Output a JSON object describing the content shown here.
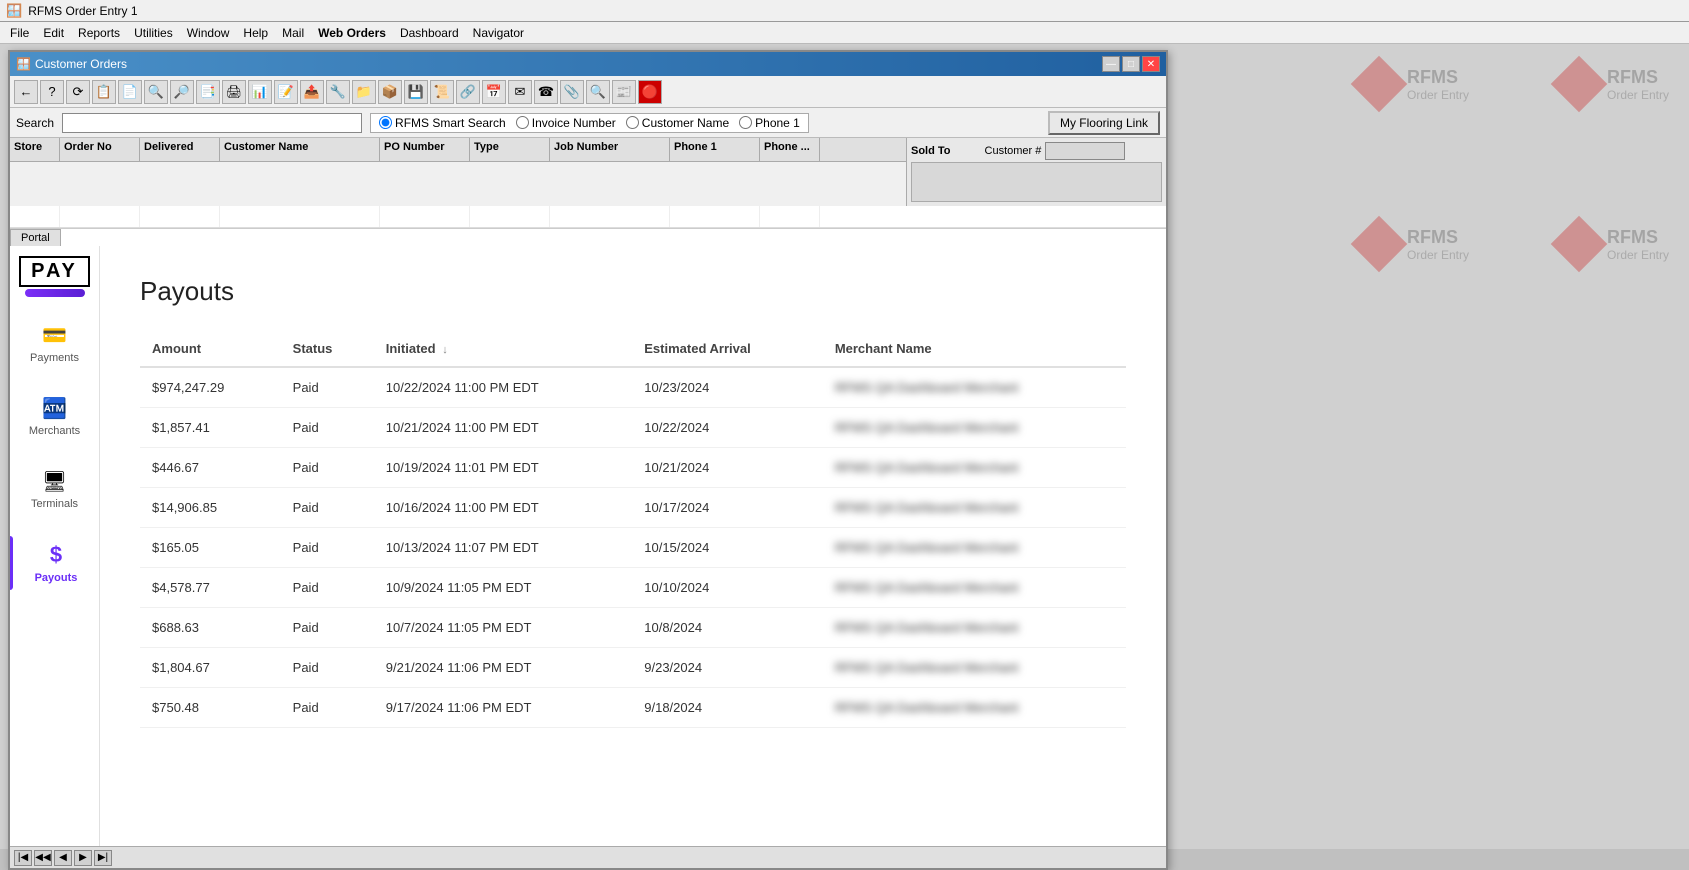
{
  "app": {
    "title": "RFMS Order Entry 1"
  },
  "menu": {
    "items": [
      "File",
      "Edit",
      "Reports",
      "Utilities",
      "Window",
      "Help",
      "Mail",
      "Web Orders",
      "Dashboard",
      "Navigator"
    ]
  },
  "window": {
    "title": "Customer Orders",
    "controls": [
      "—",
      "□",
      "✕"
    ]
  },
  "toolbar": {
    "buttons": [
      "←",
      "?",
      "⟳",
      "📋",
      "🗒",
      "🔍",
      "🔎",
      "📄",
      "🖨",
      "📑",
      "📊",
      "🔧",
      "📝",
      "📤",
      "📧",
      "🗃",
      "📦",
      "💾",
      "📜",
      "🔗",
      "📌",
      "🗂",
      "📮",
      "📅",
      "✉",
      "☎",
      "📎",
      "🔍",
      "📰",
      "🔴"
    ]
  },
  "search": {
    "label": "Search",
    "placeholder": "",
    "options": [
      "RFMS Smart Search",
      "Invoice Number",
      "Customer Name",
      "Phone 1"
    ],
    "selected": "RFMS Smart Search",
    "flooring_button": "My Flooring Link"
  },
  "columns": {
    "headers": [
      "Store",
      "Order No",
      "Delivered",
      "Customer Name",
      "PO Number",
      "Type",
      "Job Number",
      "Phone 1",
      "Phone ..."
    ]
  },
  "sold_to": {
    "label": "Sold To",
    "customer_label": "Customer #",
    "customer_value": ""
  },
  "portal": {
    "tab": "Portal"
  },
  "pay_logo": {
    "text": "PAY",
    "bar": true
  },
  "sidebar": {
    "items": [
      {
        "id": "payments",
        "label": "Payments",
        "icon": "💳",
        "active": false
      },
      {
        "id": "merchants",
        "label": "Merchants",
        "icon": "🏧",
        "active": false
      },
      {
        "id": "terminals",
        "label": "Terminals",
        "icon": "🖥",
        "active": false
      },
      {
        "id": "payouts",
        "label": "Payouts",
        "icon": "$",
        "active": true
      }
    ]
  },
  "payouts": {
    "title": "Payouts",
    "columns": [
      "Amount",
      "Status",
      "Initiated",
      "Estimated Arrival",
      "Merchant Name"
    ],
    "sort_column": "Initiated",
    "sort_direction": "desc",
    "rows": [
      {
        "amount": "$974,247.29",
        "status": "Paid",
        "initiated": "10/22/2024 11:00 PM EDT",
        "estimated_arrival": "10/23/2024",
        "merchant": "RFMS QA Dashboard Merchant"
      },
      {
        "amount": "$1,857.41",
        "status": "Paid",
        "initiated": "10/21/2024 11:00 PM EDT",
        "estimated_arrival": "10/22/2024",
        "merchant": "RFMS QA Dashboard Merchant"
      },
      {
        "amount": "$446.67",
        "status": "Paid",
        "initiated": "10/19/2024 11:01 PM EDT",
        "estimated_arrival": "10/21/2024",
        "merchant": "RFMS QA Dashboard Merchant"
      },
      {
        "amount": "$14,906.85",
        "status": "Paid",
        "initiated": "10/16/2024 11:00 PM EDT",
        "estimated_arrival": "10/17/2024",
        "merchant": "RFMS QA Dashboard Merchant"
      },
      {
        "amount": "$165.05",
        "status": "Paid",
        "initiated": "10/13/2024 11:07 PM EDT",
        "estimated_arrival": "10/15/2024",
        "merchant": "RFMS QA Dashboard Merchant"
      },
      {
        "amount": "$4,578.77",
        "status": "Paid",
        "initiated": "10/9/2024 11:05 PM EDT",
        "estimated_arrival": "10/10/2024",
        "merchant": "RFMS QA Dashboard Merchant"
      },
      {
        "amount": "$688.63",
        "status": "Paid",
        "initiated": "10/7/2024 11:05 PM EDT",
        "estimated_arrival": "10/8/2024",
        "merchant": "RFMS QA Dashboard Merchant"
      },
      {
        "amount": "$1,804.67",
        "status": "Paid",
        "initiated": "9/21/2024 11:06 PM EDT",
        "estimated_arrival": "9/23/2024",
        "merchant": "RFMS QA Dashboard Merchant"
      },
      {
        "amount": "$750.48",
        "status": "Paid",
        "initiated": "9/17/2024 11:06 PM EDT",
        "estimated_arrival": "9/18/2024",
        "merchant": "RFMS QA Dashboard Merchant"
      }
    ]
  },
  "bottom_nav": {
    "buttons": [
      "|◀",
      "◀◀",
      "◀",
      "▶",
      "▶|"
    ]
  },
  "rfms_branding": {
    "instances": [
      {
        "id": 1,
        "label": "RFMS",
        "sublabel": "Order Entry"
      },
      {
        "id": 2,
        "label": "RFMS",
        "sublabel": "Order Entry"
      },
      {
        "id": 3,
        "label": "RFMS",
        "sublabel": "Order Entry"
      },
      {
        "id": 4,
        "label": "RFMS",
        "sublabel": "Order Entry"
      }
    ]
  }
}
